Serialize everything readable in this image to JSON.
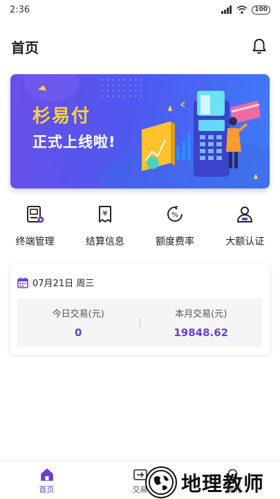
{
  "status_bar": {
    "time": "2:36",
    "battery": "100"
  },
  "header": {
    "title": "首页"
  },
  "banner": {
    "title": "杉易付",
    "subtitle": "正式上线啦!"
  },
  "quick_nav": [
    {
      "label": "终端管理",
      "icon": "terminal-icon"
    },
    {
      "label": "结算信息",
      "icon": "receipt-icon"
    },
    {
      "label": "额度费率",
      "icon": "percent-icon"
    },
    {
      "label": "大额认证",
      "icon": "user-verify-icon"
    }
  ],
  "summary": {
    "date": "07月21日 周三",
    "today_label": "今日交易(元)",
    "today_value": "0",
    "month_label": "本月交易(元)",
    "month_value": "19848.62"
  },
  "tabs": [
    {
      "label": "首页",
      "icon": "home-icon",
      "active": true
    },
    {
      "label": "交易",
      "icon": "transaction-icon",
      "active": false
    },
    {
      "label": "我的",
      "icon": "profile-icon",
      "active": false
    }
  ],
  "watermark": {
    "text": "地理教师"
  },
  "colors": {
    "accent": "#6a3fd0",
    "banner_start": "#6a4fe8",
    "banner_end": "#3d7cf7",
    "banner_title": "#ffd33a"
  }
}
